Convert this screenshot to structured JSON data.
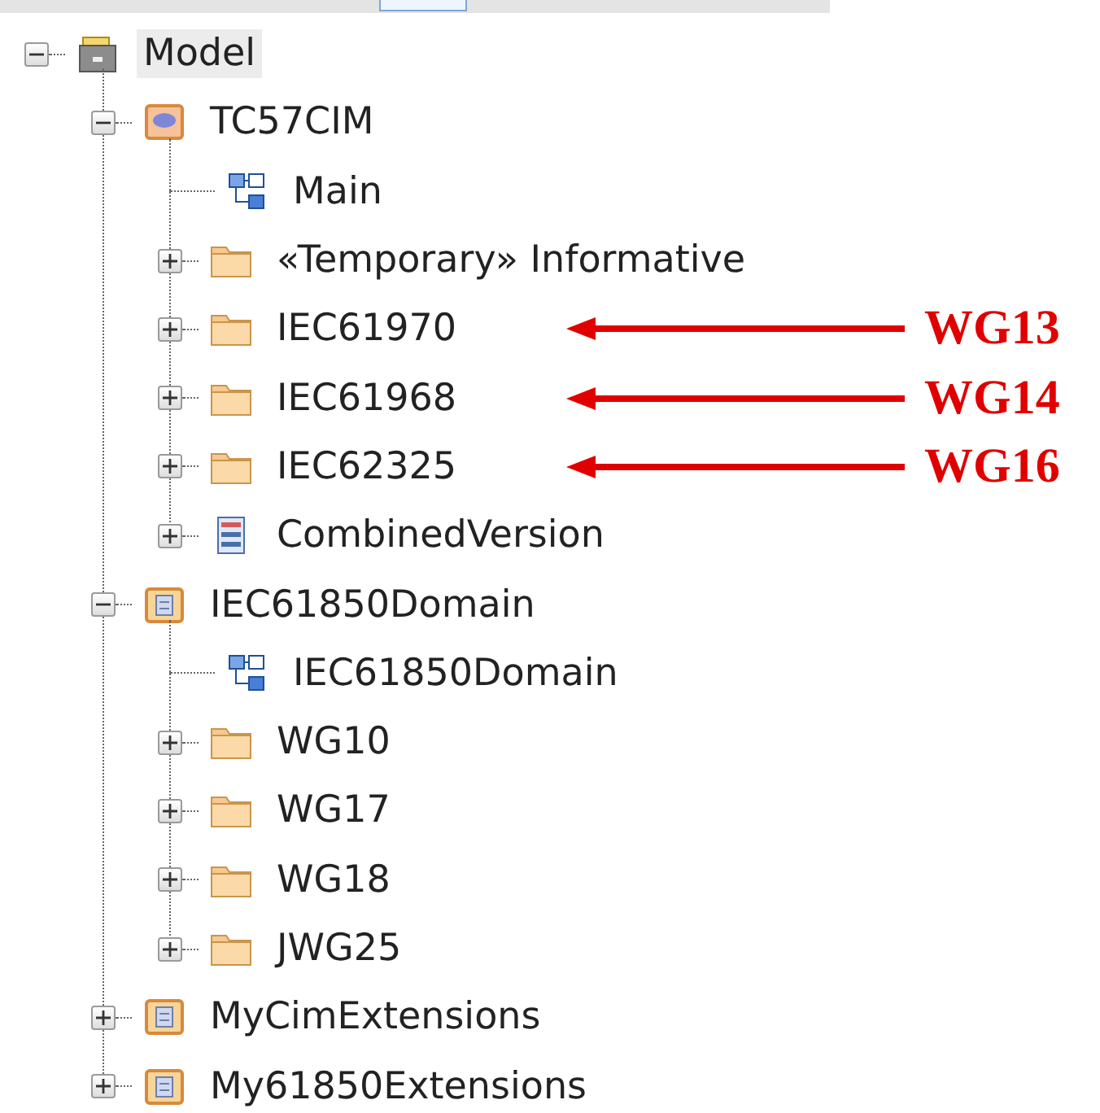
{
  "tree": [
    {
      "label": "Model",
      "kind": "model",
      "expanded": true,
      "selected": true,
      "children": [
        {
          "label": "TC57CIM",
          "kind": "namespace",
          "expanded": true,
          "selected": false,
          "children": [
            {
              "label": "Main",
              "kind": "diagram",
              "selected": false
            },
            {
              "label": "«Temporary» Informative",
              "kind": "folder",
              "expanded": false,
              "selected": false
            },
            {
              "label": "IEC61970",
              "kind": "folder",
              "expanded": false,
              "selected": false,
              "annotation": "WG13"
            },
            {
              "label": "IEC61968",
              "kind": "folder",
              "expanded": false,
              "selected": false,
              "annotation": "WG14"
            },
            {
              "label": "IEC62325",
              "kind": "folder",
              "expanded": false,
              "selected": false,
              "annotation": "WG16"
            },
            {
              "label": "CombinedVersion",
              "kind": "view",
              "expanded": false,
              "selected": false
            }
          ]
        },
        {
          "label": "IEC61850Domain",
          "kind": "package",
          "expanded": true,
          "selected": false,
          "children": [
            {
              "label": "IEC61850Domain",
              "kind": "diagram",
              "selected": false
            },
            {
              "label": "WG10",
              "kind": "folder",
              "expanded": false,
              "selected": false
            },
            {
              "label": "WG17",
              "kind": "folder",
              "expanded": false,
              "selected": false
            },
            {
              "label": "WG18",
              "kind": "folder",
              "expanded": false,
              "selected": false
            },
            {
              "label": "JWG25",
              "kind": "folder",
              "expanded": false,
              "selected": false
            }
          ]
        },
        {
          "label": "MyCimExtensions",
          "kind": "package",
          "expanded": false,
          "selected": false
        },
        {
          "label": "My61850Extensions",
          "kind": "package",
          "expanded": false,
          "selected": false
        }
      ]
    }
  ]
}
